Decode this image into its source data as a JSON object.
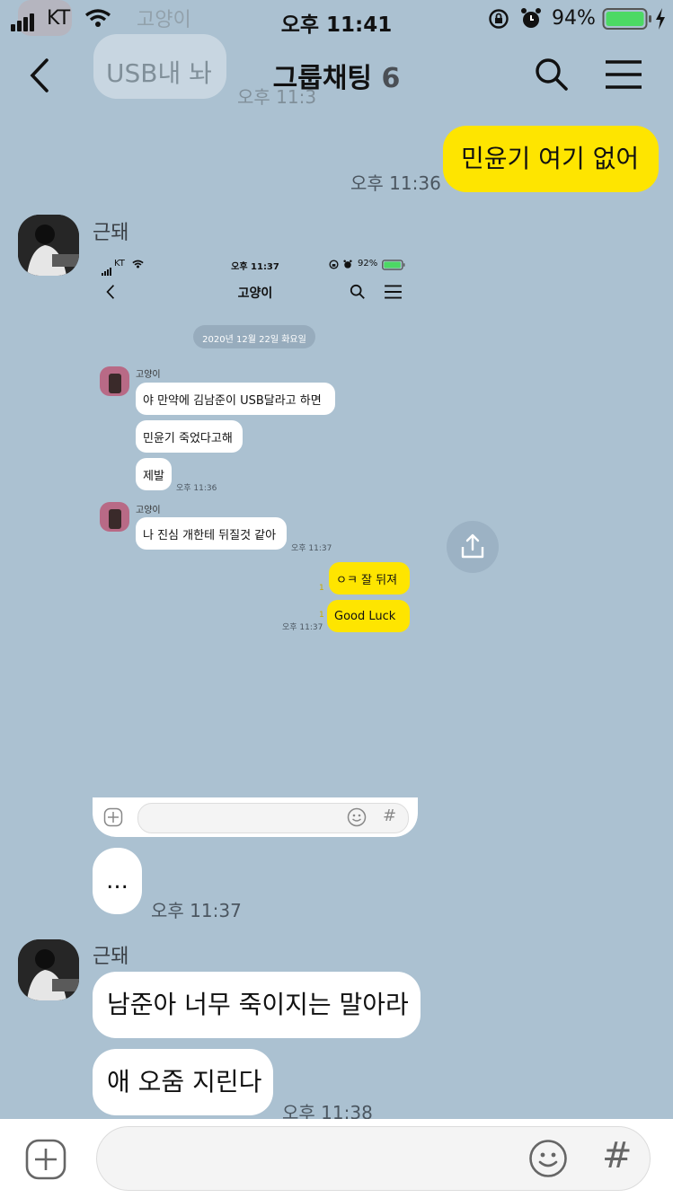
{
  "status_bar": {
    "carrier": "KT",
    "time": "오후 11:41",
    "battery": "94%"
  },
  "header": {
    "title": "그룹채팅",
    "member_count": "6"
  },
  "ghost_preview": {
    "name": "고양이",
    "message": "USB내 놔",
    "time": "오후 11:3"
  },
  "messages": {
    "m1": {
      "text": "민윤기 여기 없어",
      "time": "오후 11:36"
    },
    "m2": {
      "sender": "근돼"
    },
    "m3": {
      "text": "...",
      "time": "오후 11:37"
    },
    "m4": {
      "sender": "근돼",
      "text": "남준아 너무 죽이지는 말아라"
    },
    "m5": {
      "text": "애 오줌 지린다",
      "time": "오후 11:38"
    }
  },
  "shared_screenshot": {
    "status": {
      "carrier": "KT",
      "time": "오후 11:37",
      "battery": "92%"
    },
    "title": "고양이",
    "date_chip": "2020년 12월 22일 화요일",
    "sender1": "고양이",
    "b1": "야 만약에 김남준이 USB달라고 하면",
    "b2": "민윤기 죽었다고해",
    "b3": "제발",
    "t1": "오후 11:36",
    "sender2": "고양이",
    "b4": "나 진심 개한테 뒤질것 같아",
    "t2": "오후 11:37",
    "r1": "ㅇㅋ 잘 뒤져",
    "r1_unread": "1",
    "r2": "Good Luck",
    "r2_unread": "1",
    "t3": "오후 11:37",
    "hash": "#"
  },
  "input_bar": {
    "hash": "#"
  },
  "colors": {
    "background": "#abc1d1",
    "bubble_self": "#fee500",
    "bubble_other": "#ffffff"
  }
}
